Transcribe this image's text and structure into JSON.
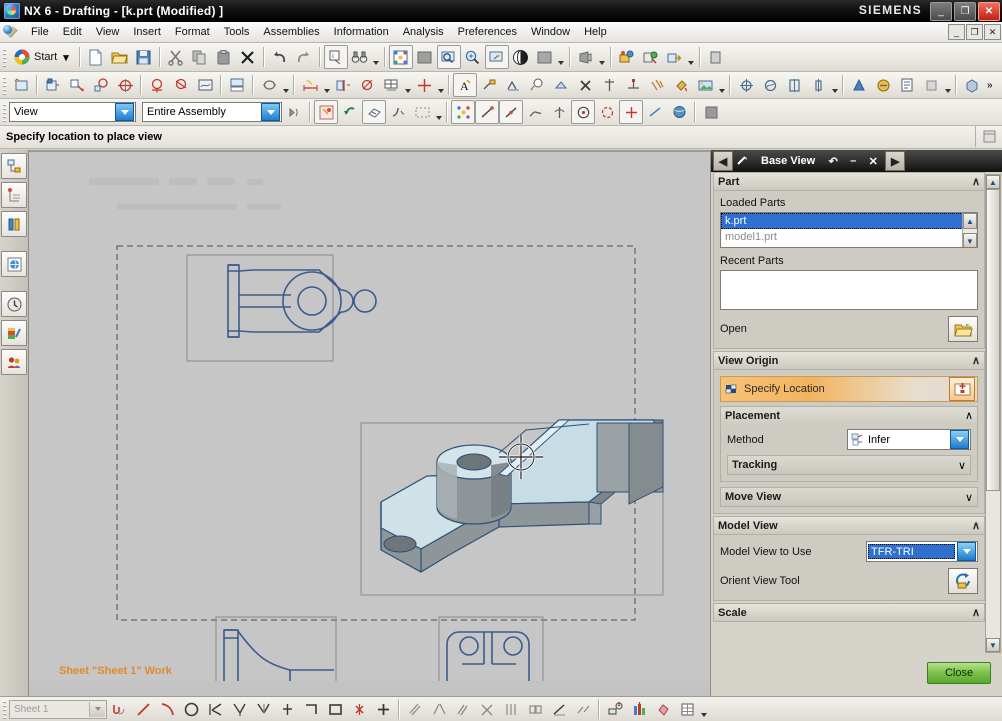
{
  "window": {
    "title": "NX 6 - Drafting - [k.prt (Modified) ]",
    "brand": "SIEMENS",
    "app_icon": "nx-logo-icon",
    "controls": {
      "minimize": "_",
      "restore": "❐",
      "close": "✕"
    },
    "mdi_controls": {
      "minimize": "_",
      "restore": "❐",
      "close": "✕"
    }
  },
  "menubar": {
    "logo_icon": "nx-drafting-icon",
    "items": [
      {
        "label": "File"
      },
      {
        "label": "Edit"
      },
      {
        "label": "View"
      },
      {
        "label": "Insert"
      },
      {
        "label": "Format"
      },
      {
        "label": "Tools"
      },
      {
        "label": "Assemblies"
      },
      {
        "label": "Information"
      },
      {
        "label": "Analysis"
      },
      {
        "label": "Preferences"
      },
      {
        "label": "Window"
      },
      {
        "label": "Help"
      }
    ]
  },
  "toolbar_standard": {
    "start_label": "Start",
    "groups": [
      {
        "tools": [
          {
            "icon": "nx-start-icon",
            "name": "start-menu"
          }
        ]
      },
      {
        "tools": [
          {
            "icon": "new-file-icon",
            "name": "new"
          },
          {
            "icon": "open-folder-icon",
            "name": "open"
          },
          {
            "icon": "save-disk-icon",
            "name": "save"
          }
        ]
      },
      {
        "tools": [
          {
            "icon": "cut-scissors-icon",
            "name": "cut"
          },
          {
            "icon": "copy-icon",
            "name": "copy"
          },
          {
            "icon": "paste-icon",
            "name": "paste"
          },
          {
            "icon": "delete-x-icon",
            "name": "delete"
          }
        ]
      },
      {
        "tools": [
          {
            "icon": "undo-arrow-icon",
            "name": "undo"
          },
          {
            "icon": "redo-arrow-icon",
            "name": "redo"
          }
        ]
      },
      {
        "tools": [
          {
            "icon": "info-object-icon",
            "name": "object-information"
          },
          {
            "icon": "binoculars-icon",
            "name": "find"
          }
        ]
      },
      {
        "tools": [
          {
            "icon": "fit-view-icon",
            "name": "fit"
          },
          {
            "icon": "zoom-window-icon",
            "name": "zoom-window"
          },
          {
            "icon": "zoom-magnifier-icon",
            "name": "zoom"
          },
          {
            "icon": "pan-icon",
            "name": "pan"
          },
          {
            "icon": "rotate-sphere-icon",
            "name": "rotate"
          },
          {
            "icon": "shaded-style-icon",
            "name": "render-style"
          }
        ]
      },
      {
        "tools": [
          {
            "icon": "perspective-icon",
            "name": "view-orientation"
          }
        ]
      },
      {
        "tools": [
          {
            "icon": "layer-settings-icon",
            "name": "layer-settings"
          },
          {
            "icon": "layer-visible-icon",
            "name": "layer-visible-in-view"
          },
          {
            "icon": "move-to-layer-icon",
            "name": "move-to-layer"
          }
        ]
      }
    ]
  },
  "toolbar_drafting": {
    "groups": [
      {
        "tools": [
          {
            "icon": "new-sheet-icon",
            "name": "new-sheet"
          }
        ]
      },
      {
        "tools": [
          {
            "icon": "base-view-icon",
            "name": "base-view"
          },
          {
            "icon": "projected-view-icon",
            "name": "projected-view"
          },
          {
            "icon": "detail-view-icon",
            "name": "detail-view"
          },
          {
            "icon": "section-view-icon",
            "name": "section-view"
          },
          {
            "icon": "half-section-icon",
            "name": "half-section-view"
          },
          {
            "icon": "revolved-section-icon",
            "name": "revolved-section-view"
          },
          {
            "icon": "break-out-section-icon",
            "name": "break-out-section"
          },
          {
            "icon": "view-dependent-edit-icon",
            "name": "view-dependent-edit"
          }
        ]
      },
      {
        "tools": [
          {
            "icon": "view-boundary-icon",
            "name": "view-boundary"
          }
        ]
      },
      {
        "tools": [
          {
            "icon": "inferred-dimension-icon",
            "name": "inferred-dimension"
          },
          {
            "icon": "horizontal-dimension-icon",
            "name": "horizontal-dimension"
          },
          {
            "icon": "vertical-dimension-icon",
            "name": "vertical-dimension"
          },
          {
            "icon": "hole-table-icon",
            "name": "hole-table"
          },
          {
            "icon": "centerline-icon",
            "name": "centerline"
          }
        ]
      },
      {
        "tools": [
          {
            "icon": "annotation-a-icon",
            "name": "note"
          },
          {
            "icon": "label-leader-icon",
            "name": "label"
          },
          {
            "icon": "surface-finish-icon",
            "name": "surface-finish-symbol"
          },
          {
            "icon": "id-symbol-icon",
            "name": "id-symbol"
          },
          {
            "icon": "custom-symbol-icon",
            "name": "custom-symbol"
          },
          {
            "icon": "delete-annotation-icon",
            "name": "delete-annotation"
          },
          {
            "icon": "edit-annotation-icon",
            "name": "edit-annotation"
          },
          {
            "icon": "balloon-icon",
            "name": "balloon"
          },
          {
            "icon": "crosshatch-icon",
            "name": "crosshatching"
          },
          {
            "icon": "area-fill-icon",
            "name": "area-fill"
          },
          {
            "icon": "image-icon",
            "name": "image"
          }
        ]
      },
      {
        "tools": [
          {
            "icon": "datum-target-icon",
            "name": "datum-target"
          },
          {
            "icon": "gdt-feature-control-icon",
            "name": "feature-control-frame"
          },
          {
            "icon": "symmetric-symbol-icon",
            "name": "symmetrical-symbol"
          },
          {
            "icon": "centerline-symbol-icon",
            "name": "centerline-symbol"
          }
        ]
      },
      {
        "tools": [
          {
            "icon": "table-note-icon",
            "name": "tabular-note"
          },
          {
            "icon": "parts-list-icon",
            "name": "parts-list"
          },
          {
            "icon": "bill-of-material-icon",
            "name": "bill-of-material"
          },
          {
            "icon": "auto-balloon-icon",
            "name": "auto-balloon"
          }
        ]
      },
      {
        "tools": [
          {
            "icon": "assembly-navigator-icon",
            "name": "assembly-tools"
          }
        ]
      }
    ],
    "overflow": "»"
  },
  "selection_bar": {
    "scope_combo": {
      "value": "View",
      "name": "selection-type-filter"
    },
    "assembly_combo": {
      "value": "Entire Assembly",
      "name": "assembly-scope-filter"
    },
    "tools": [
      {
        "icon": "snap-toggle-icon",
        "name": "snap-point-toggle"
      },
      {
        "icon": "general-select-icon",
        "name": "general-selection-filter"
      },
      {
        "icon": "reset-arrow-icon",
        "name": "reset-filters"
      },
      {
        "icon": "face-select-icon",
        "name": "face-selection"
      },
      {
        "icon": "edge-select-icon",
        "name": "edge-selection"
      },
      {
        "icon": "rectangle-select-icon",
        "name": "rectangle-selection-method"
      },
      {
        "icon": "snap-point-group-icon",
        "name": "snap-point-types"
      },
      {
        "icon": "end-point-icon",
        "name": "end-point-snap"
      },
      {
        "icon": "midpoint-icon",
        "name": "midpoint-snap"
      },
      {
        "icon": "control-point-icon",
        "name": "control-point-snap"
      },
      {
        "icon": "quadrant-point-icon",
        "name": "quadrant-point-snap"
      },
      {
        "icon": "center-point-icon",
        "name": "arc-center-snap"
      },
      {
        "icon": "intersection-point-icon",
        "name": "intersection-snap"
      },
      {
        "icon": "point-on-curve-icon",
        "name": "point-on-curve-snap"
      },
      {
        "icon": "point-on-face-icon",
        "name": "point-on-face-snap"
      },
      {
        "icon": "shaded-cube-icon",
        "name": "wcs-display"
      }
    ]
  },
  "cue_line": {
    "text": "Specify location to place view",
    "right_icon": "status-panel-icon"
  },
  "resource_bar": {
    "items": [
      {
        "icon": "assembly-navigator-icon",
        "name": "assembly-navigator"
      },
      {
        "icon": "part-navigator-icon",
        "name": "part-navigator"
      },
      {
        "icon": "reuse-library-icon",
        "name": "reuse-library"
      },
      {
        "icon": "internet-explorer-icon",
        "name": "html-browser"
      },
      {
        "icon": "history-clock-icon",
        "name": "history-palette"
      },
      {
        "icon": "system-materials-icon",
        "name": "system-scene-materials"
      },
      {
        "icon": "roles-icon",
        "name": "roles"
      }
    ]
  },
  "canvas": {
    "status_text": "Sheet \"Sheet 1\" Work",
    "sheet_label": "Sheet 1",
    "cursor_icon": "crosshair-snap-cursor",
    "views": [
      {
        "name": "front-orthographic-view",
        "label": ""
      },
      {
        "name": "isometric-shaded-view",
        "label": ""
      },
      {
        "name": "side-section-view",
        "label": ""
      },
      {
        "name": "top-orthographic-view",
        "label": ""
      }
    ]
  },
  "dialog": {
    "title": "Base View",
    "title_icon": "base-view-icon",
    "nav_back": "◀",
    "nav_forward": "▶",
    "reset_icon": "reset-icon",
    "minimize_icon": "–",
    "close_icon": "✕",
    "groups": {
      "part": {
        "title": "Part",
        "collapse": "∧",
        "loaded_parts_label": "Loaded Parts",
        "loaded_parts": [
          {
            "name": "k.prt",
            "selected": true
          },
          {
            "name": "model1.prt",
            "selected": false
          }
        ],
        "recent_parts_label": "Recent Parts",
        "recent_parts": [],
        "open_label": "Open",
        "open_icon": "open-folder-icon"
      },
      "view_origin": {
        "title": "View Origin",
        "collapse": "∧",
        "specify_location_label": "Specify Location",
        "specify_location_icon": "view-origin-icon",
        "locate_button_icon": "place-view-icon",
        "placement": {
          "title": "Placement",
          "collapse": "∧",
          "method_label": "Method",
          "method_value": "Infer",
          "method_icon": "infer-icon",
          "tracking_label": "Tracking",
          "tracking_collapse": "∨"
        },
        "move_view_label": "Move View",
        "move_view_collapse": "∨"
      },
      "model_view": {
        "title": "Model View",
        "collapse": "∧",
        "model_view_to_use_label": "Model View to Use",
        "model_view_to_use_value": "TFR-TRI",
        "orient_view_tool_label": "Orient View Tool",
        "orient_view_tool_icon": "orient-view-icon"
      },
      "scale": {
        "title": "Scale",
        "collapse": "∧"
      }
    },
    "close_button": "Close"
  },
  "bottom_bar": {
    "sheet_combo_value": "Sheet 1",
    "tools": [
      {
        "icon": "studio-spline-icon",
        "name": "studio-spline"
      },
      {
        "icon": "line-icon",
        "name": "line"
      },
      {
        "icon": "arc-icon",
        "name": "arc"
      },
      {
        "icon": "circle-icon",
        "name": "circle"
      },
      {
        "icon": "fillet-icon",
        "name": "fillet"
      },
      {
        "icon": "chamfer-icon",
        "name": "chamfer"
      },
      {
        "icon": "trim-icon",
        "name": "trim"
      },
      {
        "icon": "extend-icon",
        "name": "extend"
      },
      {
        "icon": "rectangle-icon",
        "name": "rectangle"
      },
      {
        "icon": "point-icon",
        "name": "point"
      },
      {
        "icon": "plus-icon",
        "name": "point-set"
      },
      {
        "icon": "offset-curve-icon",
        "name": "offset-curve"
      },
      {
        "icon": "mirror-curve-icon",
        "name": "mirror-curve"
      },
      {
        "icon": "bridge-curve-icon",
        "name": "bridge-curve"
      },
      {
        "icon": "intersect-curve-icon",
        "name": "intersection-curve"
      },
      {
        "icon": "project-curve-icon",
        "name": "project-curve"
      },
      {
        "icon": "combine-curve-icon",
        "name": "combine-curves"
      },
      {
        "icon": "simplify-curve-icon",
        "name": "simplify-curve"
      },
      {
        "icon": "divide-curve-icon",
        "name": "divide-curve"
      },
      {
        "icon": "add-constraint-icon",
        "name": "add-constraint"
      },
      {
        "icon": "sketch-dimension-icon",
        "name": "sketch-dimension"
      },
      {
        "icon": "sketch-region-icon",
        "name": "sketch-region"
      },
      {
        "icon": "sketch-table-icon",
        "name": "sketch-table"
      }
    ]
  },
  "colors": {
    "accent_orange": "#e08a2e",
    "selection_blue": "#2f6fce",
    "dialog_bg": "#d6d3cb",
    "canvas_bg": "#c6c6c6",
    "part_light": "#c8dfe6",
    "part_dark": "#8b9294",
    "edge_blue": "#2a4a7a",
    "close_green": "#7fc34e"
  }
}
